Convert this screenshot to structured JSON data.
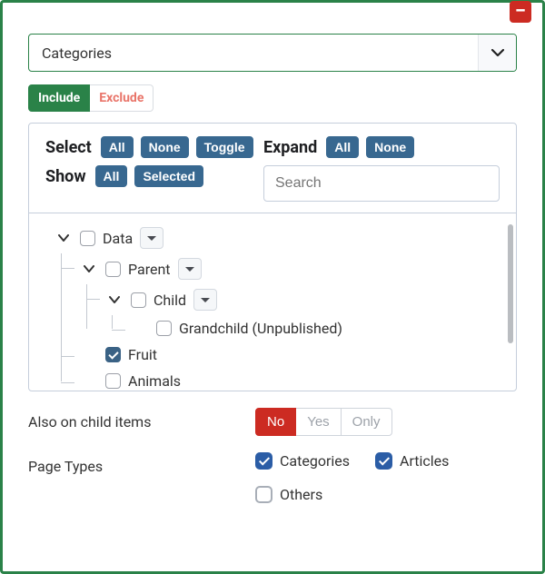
{
  "close_icon_glyph": "−",
  "dropdown": {
    "label": "Categories"
  },
  "ie": {
    "include": "Include",
    "exclude": "Exclude"
  },
  "controls": {
    "select_label": "Select",
    "select_buttons": [
      "All",
      "None",
      "Toggle"
    ],
    "show_label": "Show",
    "show_buttons": [
      "All",
      "Selected"
    ],
    "expand_label": "Expand",
    "expand_buttons": [
      "All",
      "None"
    ],
    "search_placeholder": "Search"
  },
  "tree": {
    "root": {
      "label": "Data",
      "checked": false,
      "has_dropdown": true,
      "children": [
        {
          "label": "Parent",
          "checked": false,
          "has_dropdown": true,
          "children": [
            {
              "label": "Child",
              "checked": false,
              "has_dropdown": true,
              "children": [
                {
                  "label": "Grandchild (Unpublished)",
                  "checked": false,
                  "has_dropdown": false,
                  "children": []
                }
              ]
            }
          ]
        },
        {
          "label": "Fruit",
          "checked": true,
          "has_dropdown": false,
          "children": []
        },
        {
          "label": "Animals",
          "checked": false,
          "has_dropdown": false,
          "children": []
        }
      ]
    }
  },
  "also_on_child": {
    "label": "Also on child items",
    "options": [
      "No",
      "Yes",
      "Only"
    ],
    "active": "No"
  },
  "page_types": {
    "label": "Page Types",
    "items": [
      {
        "label": "Categories",
        "checked": true
      },
      {
        "label": "Articles",
        "checked": true
      },
      {
        "label": "Others",
        "checked": false
      }
    ]
  }
}
